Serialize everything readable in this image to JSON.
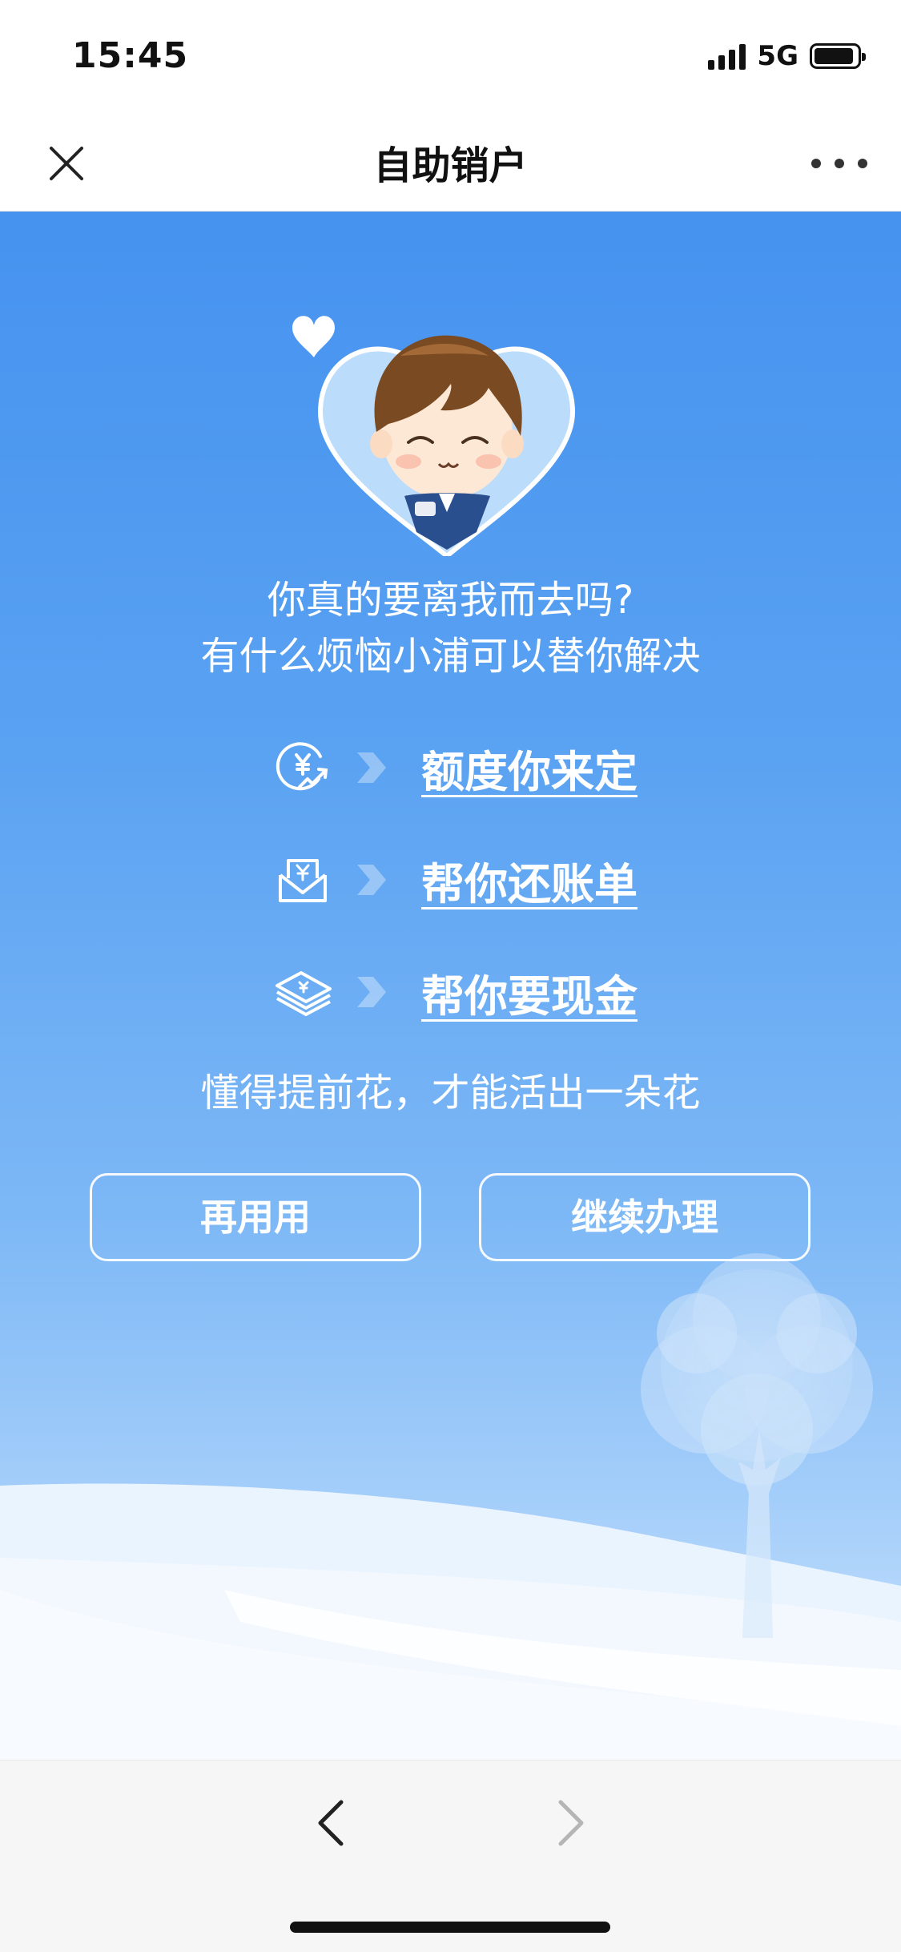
{
  "status_bar": {
    "time": "15:45",
    "network": "5G"
  },
  "nav": {
    "title": "自助销户"
  },
  "hero": {
    "headline_line1": "你真的要离我而去吗?",
    "headline_line2": "有什么烦恼小浦可以替你解决",
    "offers": [
      {
        "icon": "yen-growth-icon",
        "label": "额度你来定"
      },
      {
        "icon": "bill-envelope-icon",
        "label": "帮你还账单"
      },
      {
        "icon": "cash-stack-icon",
        "label": "帮你要现金"
      }
    ],
    "slogan": "懂得提前花，才能活出一朵花",
    "buttons": {
      "stay": "再用用",
      "continue": "继续办理"
    }
  },
  "colors": {
    "sky_top": "#4592ef",
    "sky_bottom": "#cfe6fd",
    "text": "#ffffff"
  }
}
